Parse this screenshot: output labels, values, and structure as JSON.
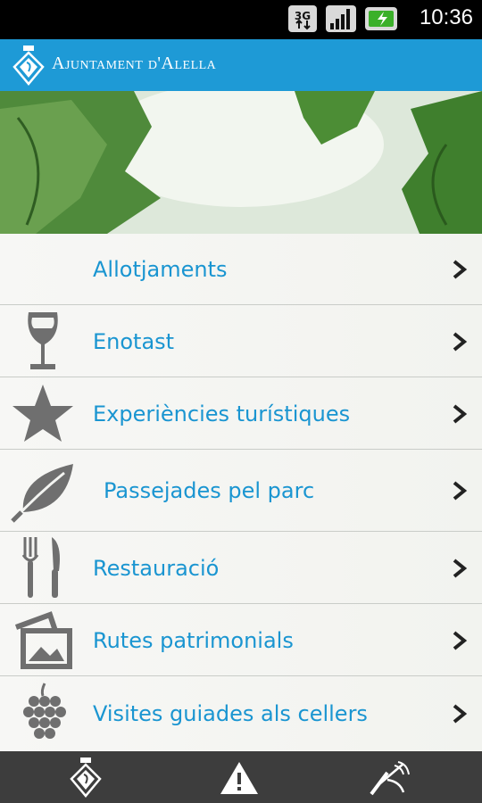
{
  "status_bar": {
    "network": "3G",
    "time": "10:36",
    "icons": [
      "network-3g-icon",
      "signal-icon",
      "battery-icon"
    ]
  },
  "header": {
    "title": "Ajuntament d'Alella",
    "logo_icon": "crest-icon"
  },
  "menu": {
    "items": [
      {
        "label": "Allotjaments",
        "icon": "moon-icon"
      },
      {
        "label": "Enotast",
        "icon": "wine-glass-icon"
      },
      {
        "label": "Experiències turístiques",
        "icon": "star-icon"
      },
      {
        "label": "Passejades pel parc",
        "icon": "leaf-icon"
      },
      {
        "label": "Restauració",
        "icon": "fork-knife-icon"
      },
      {
        "label": "Rutes patrimonials",
        "icon": "photos-icon"
      },
      {
        "label": "Visites guiades als cellers",
        "icon": "grapes-icon"
      }
    ]
  },
  "bottom_bar": {
    "buttons": [
      "crest-icon",
      "warning-icon",
      "satellite-icon"
    ]
  },
  "colors": {
    "header": "#1e9ad6",
    "label": "#1a95d1",
    "icon_gray": "#6f6f6f",
    "bottom_bar": "#3d3d3d"
  }
}
